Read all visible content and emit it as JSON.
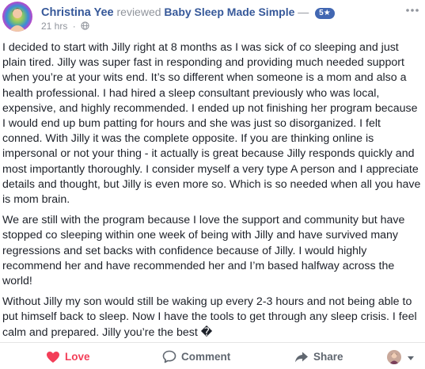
{
  "header": {
    "author": "Christina Yee",
    "reviewed_text": "reviewed",
    "page_name": "Baby Sleep Made Simple",
    "dash": "—",
    "rating": "5★",
    "time": "21 hrs",
    "dot": "·",
    "privacy_icon": "globe-icon",
    "more_icon": "more-options-icon"
  },
  "body": {
    "paragraphs": [
      "I decided to start with Jilly right at 8 months as I was sick of co sleeping and just plain tired. Jilly was super fast in responding and providing much needed support when you’re at your wits end. It’s so different when someone is a mom and also a health professional. I had hired a sleep consultant previously who was local, expensive, and highly recommended. I ended up not finishing her program because I would end up bum patting for hours and she was just so disorganized. I felt conned. With Jilly it was the complete opposite. If you are thinking online is impersonal or not your thing - it actually is great because Jilly responds quickly and most importantly thoroughly. I consider myself a very type A person and I appreciate details and thought, but Jilly is even more so. Which is so needed when all you have is mom brain.",
      "We are still with the program because I love the support and community but have stopped co sleeping within one week of being with Jilly and have survived many regressions and set backs with confidence because of Jilly. I would highly recommend her and have recommended her and I’m based halfway across the world!",
      "Without Jilly my son would still be waking up every 2-3 hours and not being able to put himself back to sleep. Now I have the tools to get through any sleep crisis. I feel calm and prepared. Jilly you’re the best �"
    ]
  },
  "actions": {
    "love_label": "Love",
    "comment_label": "Comment",
    "share_label": "Share"
  },
  "colors": {
    "link": "#365899",
    "love": "#f33e58",
    "badge": "#4267b2",
    "muted": "#90949c"
  }
}
